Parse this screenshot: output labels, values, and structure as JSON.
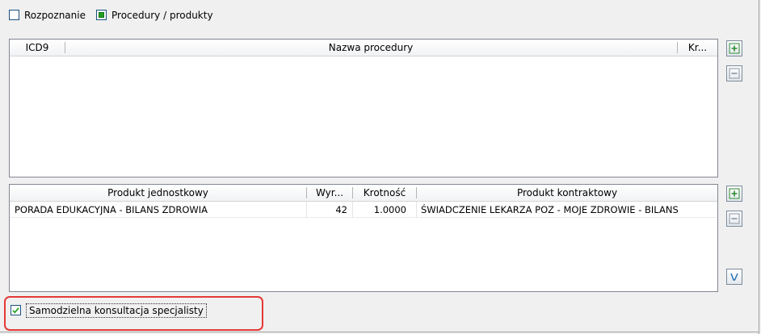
{
  "top_options": {
    "rozpoznanie_label": "Rozpoznanie",
    "procedury_label": "Procedury / produkty"
  },
  "procedures_table": {
    "columns": [
      "ICD9",
      "Nazwa procedury",
      "Kr..."
    ],
    "rows": []
  },
  "products_table": {
    "columns": [
      "Produkt jednostkowy",
      "Wyr...",
      "Krotność",
      "Produkt kontraktowy"
    ],
    "rows": [
      {
        "produkt_jednostkowy": "PORADA EDUKACYJNA - BILANS ZDROWIA",
        "wyr": "42",
        "krotnosc": "1.0000",
        "produkt_kontraktowy": "ŚWIADCZENIE LEKARZA POZ - MOJE ZDROWIE - BILANS"
      }
    ]
  },
  "bottom": {
    "samodzielna_label": "Samodzielna konsultacja specjalisty",
    "samodzielna_checked": true
  },
  "colors": {
    "highlight": "#e53935",
    "add_icon": "#2e8b2e",
    "checkbox_fill": "#21a121"
  },
  "icons": {
    "add": "plus-icon",
    "remove": "minus-icon",
    "edit": "edit-icon"
  }
}
